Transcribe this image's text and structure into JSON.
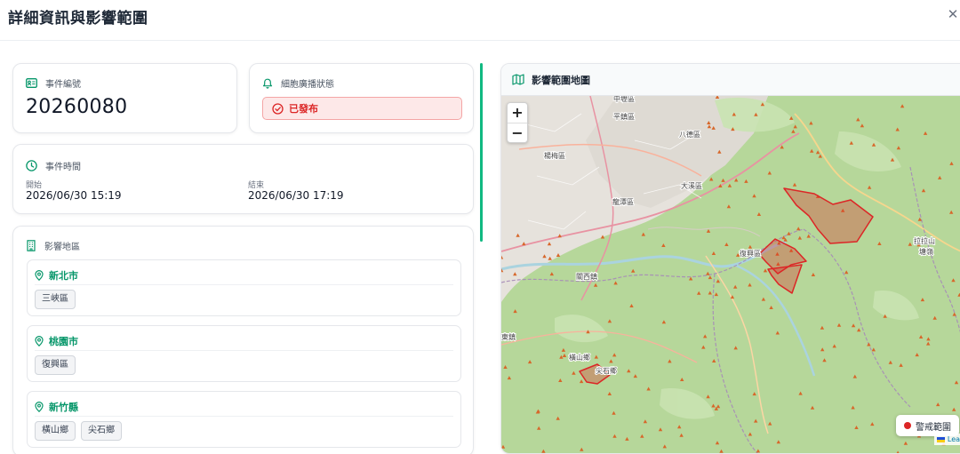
{
  "header": {
    "title": "詳細資訊與影響範圍",
    "close_icon": "close-icon"
  },
  "event": {
    "label": "事件編號",
    "icon": "id-card-icon",
    "value": "20260080"
  },
  "status": {
    "label": "細胞廣播狀態",
    "icon": "bell-icon",
    "badge_text": "已發布",
    "badge_icon": "check-circle-icon",
    "color": "#dc2626"
  },
  "time": {
    "label": "事件時間",
    "icon": "clock-icon",
    "start_label": "開始",
    "start_value": "2026/06/30 15:19",
    "end_label": "結束",
    "end_value": "2026/06/30 17:19"
  },
  "area": {
    "label": "影響地區",
    "icon": "building-icon",
    "regions": [
      {
        "name": "新北市",
        "districts": [
          "三峽區"
        ]
      },
      {
        "name": "桃園市",
        "districts": [
          "復興區"
        ]
      },
      {
        "name": "新竹縣",
        "districts": [
          "橫山鄉",
          "尖石鄉"
        ]
      }
    ]
  },
  "map": {
    "title": "影響範圍地圖",
    "icon": "map-icon",
    "zoom_in": "+",
    "zoom_out": "−",
    "legend": "警戒範圍",
    "attribution": "Leafle",
    "place_labels": [
      "中壢區",
      "平鎮區",
      "八德區",
      "楊梅區",
      "大溪區",
      "龍潭區",
      "復興區",
      "關西鎮",
      "東鎮",
      "橫山鄉",
      "尖石鄉",
      "拉拉山",
      "塘嶺"
    ],
    "accent_color": "#10b981",
    "polygon_color": "#dc2626"
  }
}
